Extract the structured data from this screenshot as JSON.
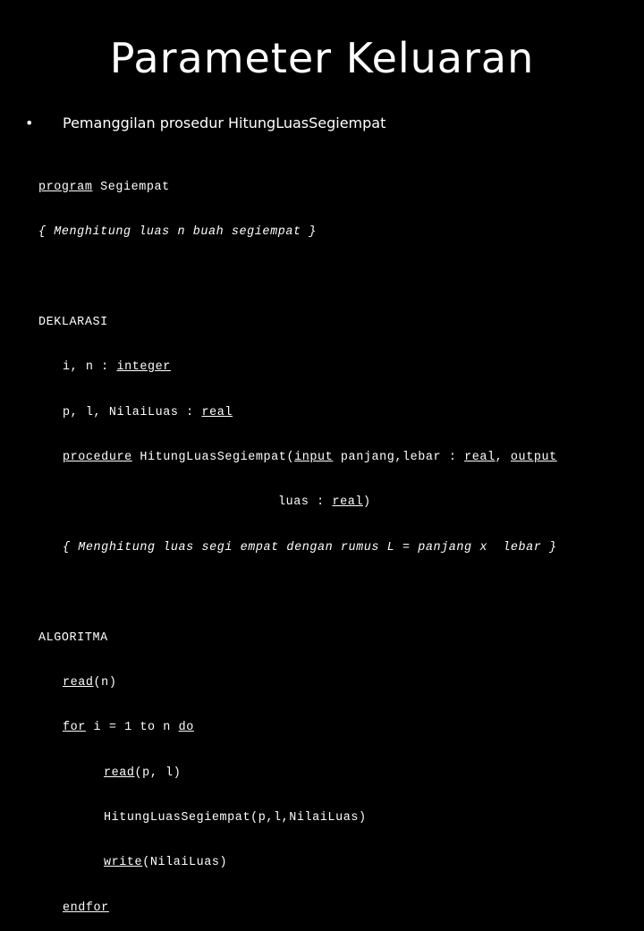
{
  "slide": {
    "title": "Parameter Keluaran",
    "bullet_symbol": "•",
    "bullet_text": "Pemanggilan prosedur HitungLuasSegiempat"
  },
  "code": {
    "header": {
      "kw_program": "program",
      "name": " Segiempat"
    },
    "header_comment": "{ Menghitung luas n buah segiempat }",
    "deklarasi_label": "DEKLARASI",
    "decl1": {
      "text": "i, n : ",
      "type": "integer"
    },
    "decl2": {
      "text": "p, l, NilaiLuas : ",
      "type": "real"
    },
    "proc": {
      "kw_procedure": "procedure",
      "name": " HitungLuasSegiempat(",
      "kw_input": "input",
      "params": " panjang,lebar : ",
      "type1": "real",
      "sep": ", ",
      "kw_output": "output",
      "cont_text": "luas : ",
      "type2": "real",
      "close": ")"
    },
    "proc_comment": "{ Menghitung luas segi empat dengan rumus L = panjang x  lebar }",
    "algoritma_label": "ALGORITMA",
    "read_n": {
      "kw": "read",
      "args": "(n)"
    },
    "for_line": {
      "kw_for": "for",
      "mid": " i = 1 to n ",
      "kw_do": "do"
    },
    "read_pl": {
      "kw": "read",
      "args": "(p, l)"
    },
    "call_line": "HitungLuasSegiempat(p,l,NilaiLuas)",
    "write_line": {
      "kw": "write",
      "args": "(NilaiLuas)"
    },
    "endfor": "endfor"
  }
}
